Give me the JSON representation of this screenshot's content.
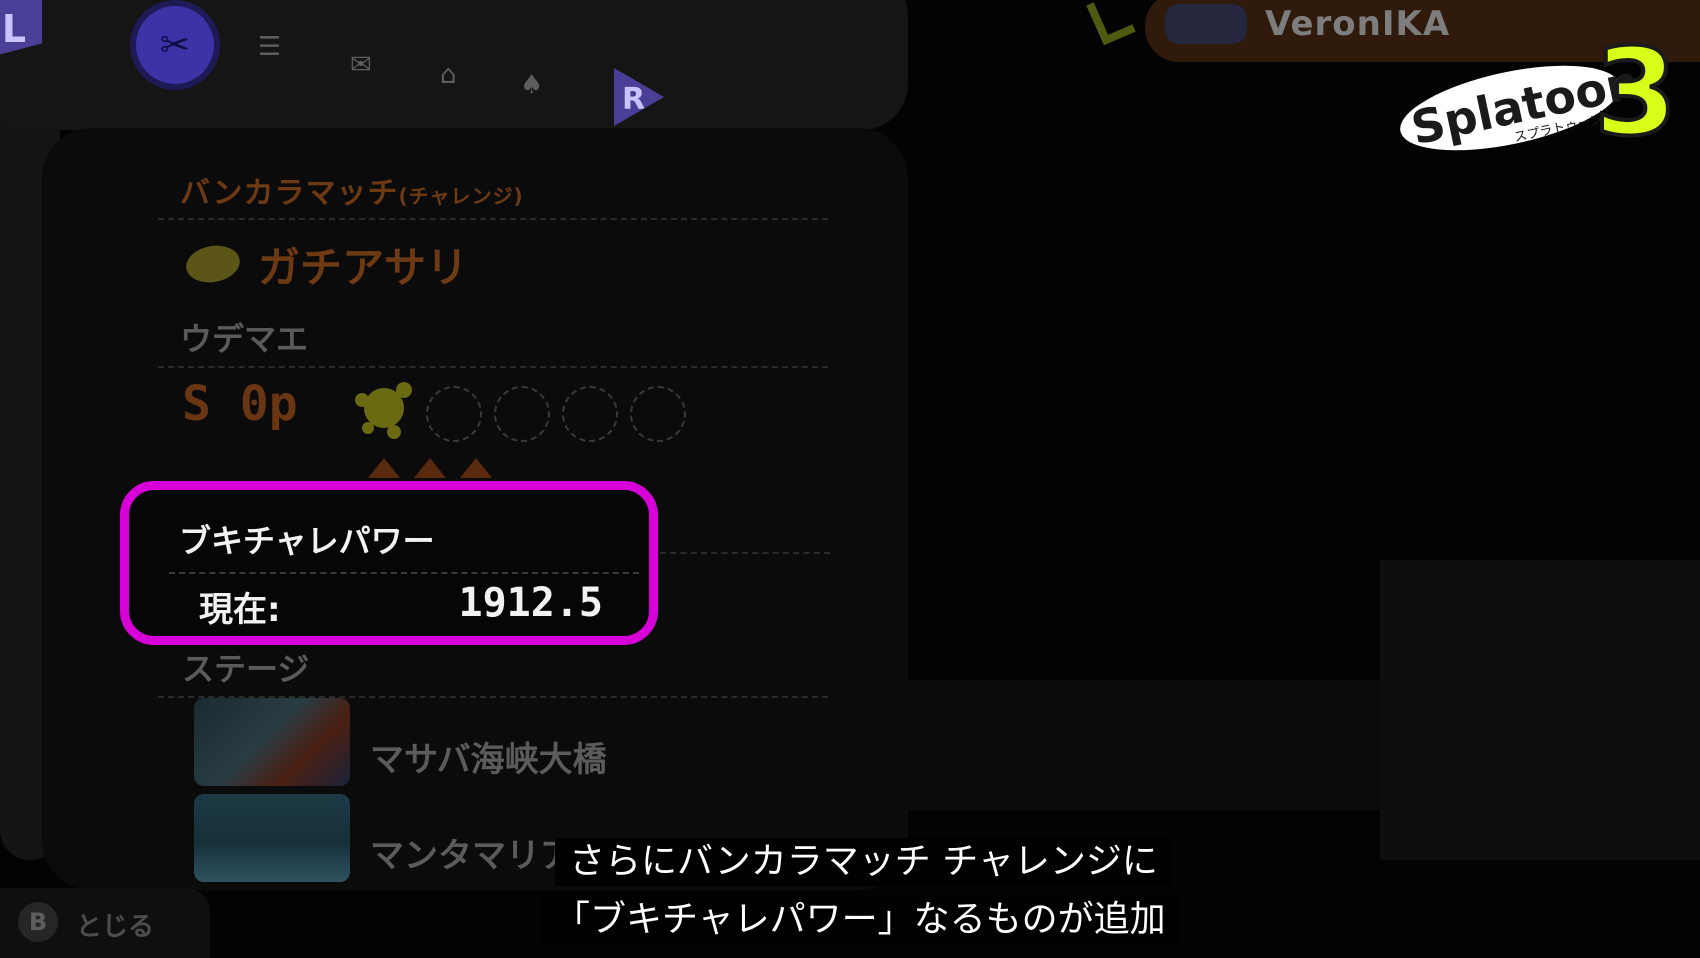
{
  "nav": {
    "left_button": "L",
    "right_button": "R",
    "tabs": [
      "lobby-icon",
      "list-icon",
      "mail-icon",
      "shop-icon",
      "squid-icon"
    ]
  },
  "player": {
    "name": "VeronIKA",
    "weapon_icon": "splattershot-icon"
  },
  "logo": {
    "text": "Splatoon",
    "number": "3",
    "sub": "スプラトゥーン"
  },
  "panel": {
    "mode_title": "バンカラマッチ",
    "mode_sub": "(チャレンジ)",
    "rule_name": "ガチアサリ",
    "rule_icon": "clam-icon",
    "udemae_label": "ウデマエ",
    "rank": "S 0p",
    "points_filled": 1,
    "points_total": 5,
    "wins_markers": 3
  },
  "power": {
    "label": "ブキチャレパワー",
    "current_label": "現在:",
    "current_value": "1912.5",
    "highlight_color": "#d800d8"
  },
  "stages": {
    "label": "ステージ",
    "items": [
      {
        "name": "マサバ海峡大橋"
      },
      {
        "name": "マンタマリア号"
      }
    ]
  },
  "close_hint": {
    "button": "B",
    "label": "とじる"
  },
  "subtitles": {
    "line1": "さらにバンカラマッチ チャレンジに",
    "line2": "「ブキチャレパワー」なるものが追加"
  }
}
